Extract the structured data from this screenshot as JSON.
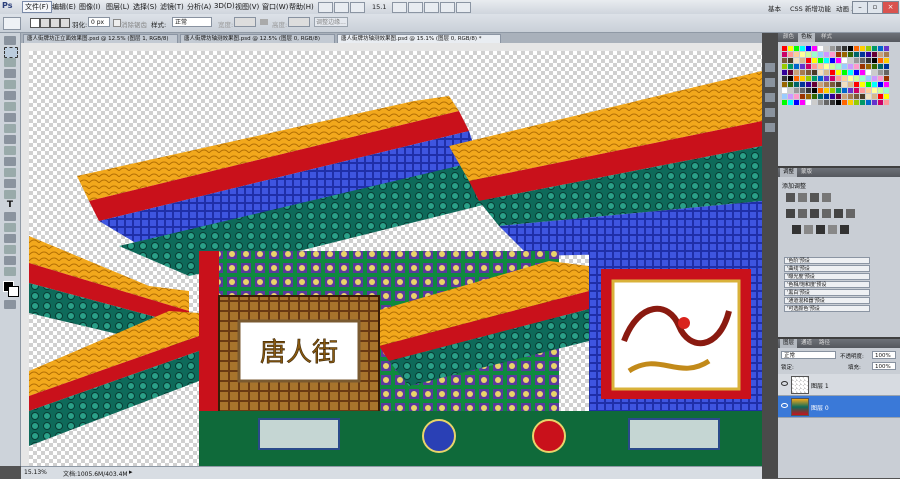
{
  "menubar": {
    "app_logo": "Ps",
    "items": [
      "文件(F)",
      "编辑(E)",
      "图像(I)",
      "图层(L)",
      "选择(S)",
      "滤镜(T)",
      "分析(A)",
      "3D(D)",
      "视图(V)",
      "窗口(W)",
      "帮助(H)"
    ],
    "zoom_value": "15.1",
    "workspaces": [
      "基本",
      "CSS 新增功能",
      "动画 3D"
    ]
  },
  "options": {
    "feather_label": "羽化:",
    "feather_value": "0 px",
    "antialias_label": "消除锯齿",
    "style_label": "样式:",
    "style_value": "正常",
    "width_label": "宽度:",
    "height_label": "高度:",
    "refine_edge_label": "调整边缘..."
  },
  "tabs": [
    {
      "label": "唐人街牌坊正立面效果图.psd @ 12.5% (图层 1, RGB/8)"
    },
    {
      "label": "唐人街牌坊轴测效果图.psd @ 12.5% (图层 0, RGB/8)"
    },
    {
      "label": "唐人街牌坊轴测效果图.psd @ 15.1% (图层 0, RGB/8) *"
    }
  ],
  "canvas": {
    "sign_text": "唐人街"
  },
  "status": {
    "zoom": "15.13%",
    "doc_info": "文档:1005.6M/403.4M"
  },
  "color_panel": {
    "tabs": [
      "颜色",
      "色板",
      "样式"
    ],
    "swatch_colors": [
      "#ff0000",
      "#ffff00",
      "#00ff00",
      "#00ffff",
      "#0000ff",
      "#ff00ff",
      "#ffffff",
      "#cccccc",
      "#999999",
      "#666666",
      "#333333",
      "#000000",
      "#ff6600",
      "#ffcc00",
      "#99cc00",
      "#009966",
      "#0066cc",
      "#6633cc",
      "#cc0066",
      "#ff9999",
      "#ffcc99",
      "#ffff99",
      "#ccff99",
      "#99ffcc",
      "#99ccff",
      "#cc99ff",
      "#ff99cc",
      "#993300",
      "#996600",
      "#336600",
      "#006666",
      "#003399",
      "#330099",
      "#660033",
      "#c8a27a",
      "#a67c52",
      "#7b5a3a",
      "#4d3a26",
      "#f2e0c0",
      "#d6b98c"
    ]
  },
  "adjustments_panel": {
    "tabs": [
      "调整",
      "蒙版"
    ],
    "title": "添加调整",
    "presets": [
      "'色阶'预设",
      "'曲线'预设",
      "'曝光度'预设",
      "'色相/饱和度'预设",
      "'黑白'预设",
      "'通道混和器'预设",
      "'可选颜色'预设"
    ]
  },
  "layers_panel": {
    "tabs": [
      "图层",
      "通道",
      "路径"
    ],
    "blend_mode": "正常",
    "opacity_label": "不透明度:",
    "opacity_value": "100%",
    "lock_label": "锁定:",
    "fill_label": "填充:",
    "fill_value": "100%",
    "layers": [
      {
        "name": "图层 1",
        "selected": false
      },
      {
        "name": "图层 0",
        "selected": true
      }
    ]
  }
}
